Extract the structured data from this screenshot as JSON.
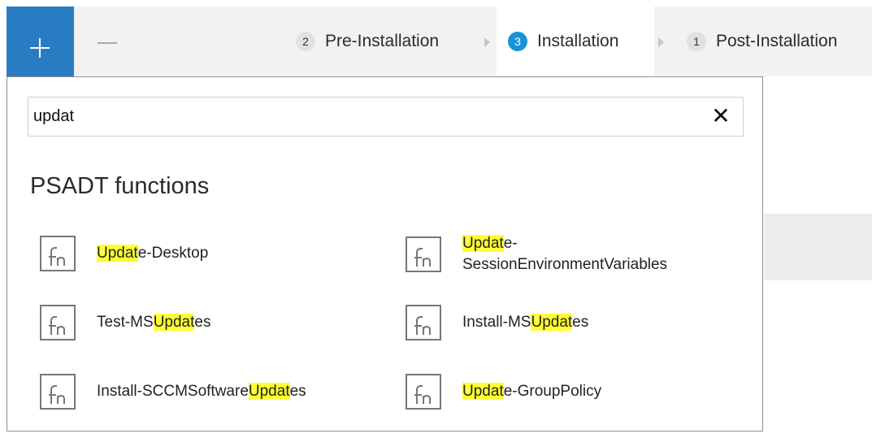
{
  "toolbar": {
    "add_icon": "plus-icon",
    "remove_icon": "minus-icon",
    "steps": [
      {
        "number": "2",
        "label": "Pre-Installation",
        "active": false
      },
      {
        "number": "3",
        "label": "Installation",
        "active": true
      },
      {
        "number": "1",
        "label": "Post-Installation",
        "active": false
      }
    ]
  },
  "search": {
    "value": "updat",
    "clear_icon": "close-icon"
  },
  "results": {
    "section_title": "PSADT functions",
    "icon": "function-icon",
    "items": [
      {
        "pre": "",
        "match": "Updat",
        "post": "e-Desktop"
      },
      {
        "pre": "",
        "match": "Updat",
        "post": "e-SessionEnvironmentVariables",
        "line1": "e-",
        "line2": "SessionEnvironmentVariables"
      },
      {
        "pre": "Test-MS",
        "match": "Updat",
        "post": "es"
      },
      {
        "pre": "Install-MS",
        "match": "Updat",
        "post": "es"
      },
      {
        "pre": "Install-SCCMSoftware",
        "match": "Updat",
        "post": "es"
      },
      {
        "pre": "",
        "match": "Updat",
        "post": "e-GroupPolicy"
      }
    ]
  },
  "colors": {
    "accent": "#2a7cc2",
    "step_active_badge": "#1993d6",
    "highlight": "#ffff33"
  }
}
